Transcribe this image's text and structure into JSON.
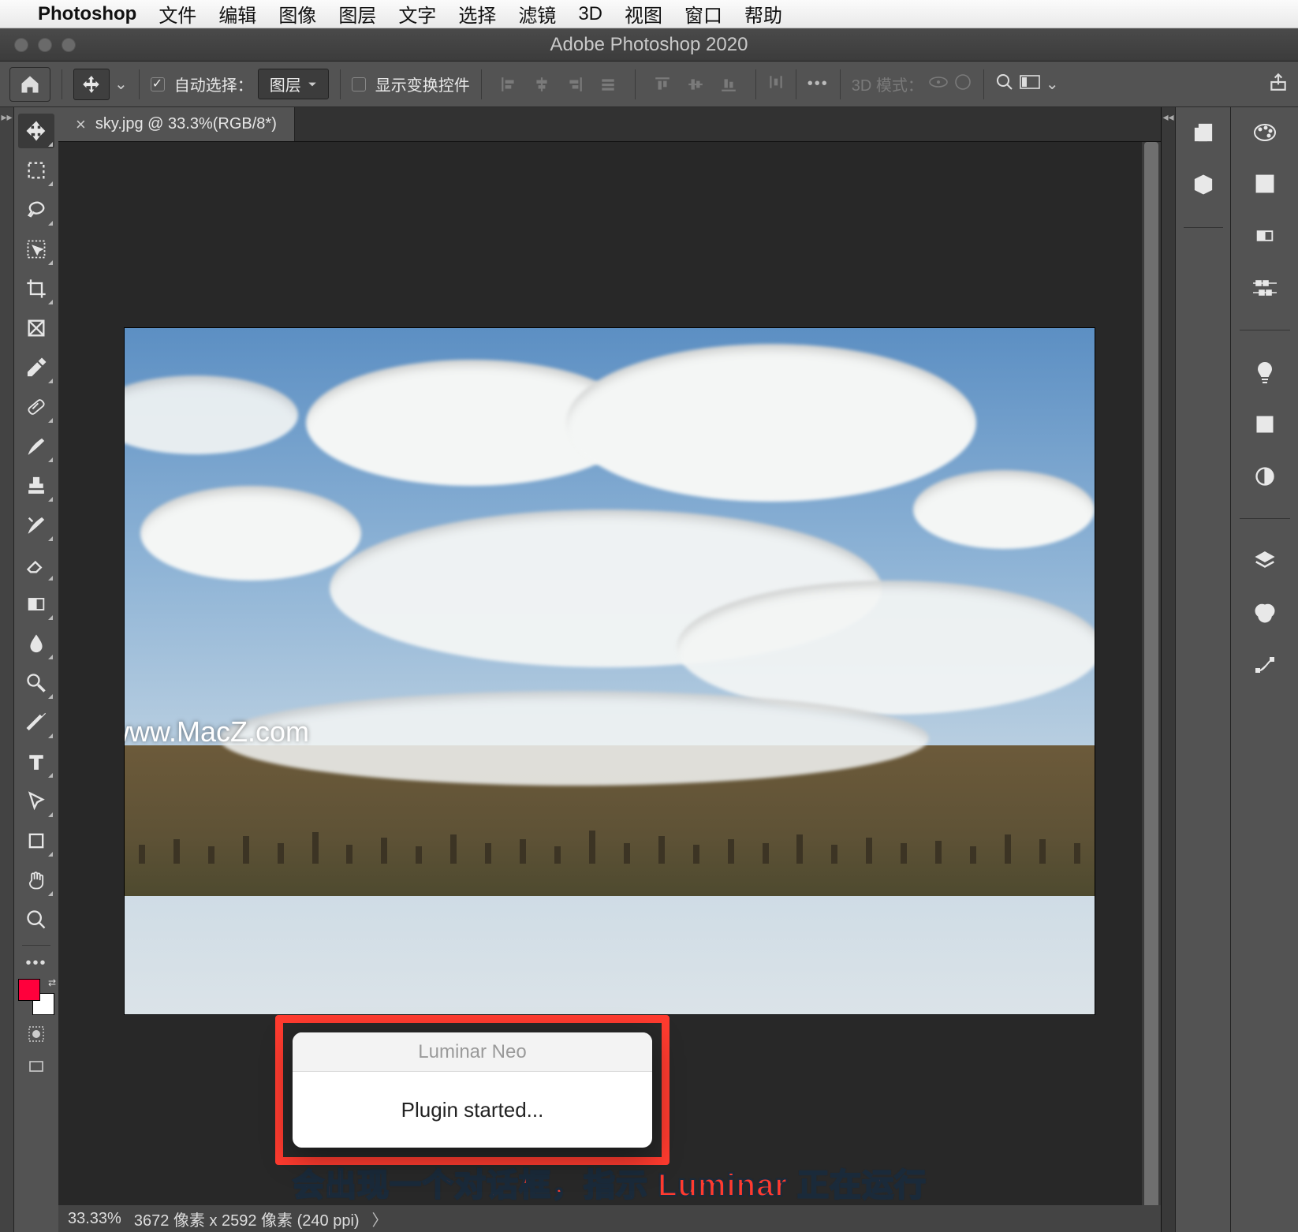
{
  "menubar": {
    "app": "Photoshop",
    "items": [
      "文件",
      "编辑",
      "图像",
      "图层",
      "文字",
      "选择",
      "滤镜",
      "3D",
      "视图",
      "窗口",
      "帮助"
    ]
  },
  "window": {
    "title": "Adobe Photoshop 2020"
  },
  "options": {
    "auto_select_label": "自动选择：",
    "layer_dropdown": "图层",
    "show_transform_label": "显示变换控件",
    "mode3d_label": "3D 模式："
  },
  "tab": {
    "filename": "sky.jpg @ 33.3%(RGB/8*)"
  },
  "watermark": {
    "text": "www.MacZ.com"
  },
  "dialog": {
    "title": "Luminar Neo",
    "message": "Plugin started..."
  },
  "annotation": {
    "text": "会出现一个对话框，指示 Luminar 正在运行"
  },
  "status": {
    "zoom": "33.33%",
    "dims": "3672 像素 x 2592 像素 (240 ppi)"
  }
}
